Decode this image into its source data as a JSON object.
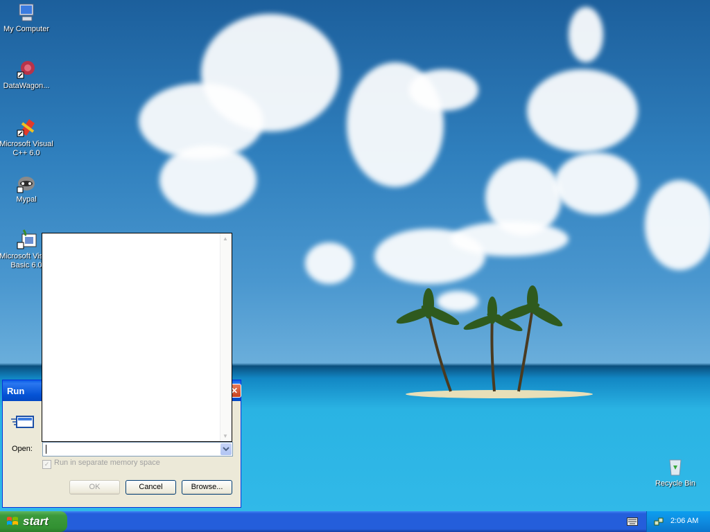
{
  "desktop": {
    "icons": [
      {
        "label": "My Computer",
        "icon": "computer-icon"
      },
      {
        "label": "DataWagon...",
        "icon": "datawagon-shortcut-icon"
      },
      {
        "label": "Microsoft Visual C++ 6.0",
        "icon": "visual-cpp-shortcut-icon"
      },
      {
        "label": "Mypal",
        "icon": "mypal-shortcut-icon"
      },
      {
        "label": "Microsoft Visual Basic 6.0",
        "icon": "visual-basic-shortcut-icon"
      },
      {
        "label": "Recycle Bin",
        "icon": "recycle-bin-icon"
      }
    ]
  },
  "run_dialog": {
    "title": "Run",
    "close_glyph": "✕",
    "open_label": "Open:",
    "open_value": "",
    "separate_memory_label": "Run in separate memory space",
    "separate_memory_checked": true,
    "separate_memory_enabled": false,
    "ok_label": "OK",
    "cancel_label": "Cancel",
    "browse_label": "Browse..."
  },
  "taskbar": {
    "start_label": "start",
    "clock": "2:06 AM"
  },
  "colors": {
    "taskbar": "#245edb",
    "start": "#329132",
    "titlebar": "#0553d5",
    "dialog_face": "#ece9d8"
  }
}
